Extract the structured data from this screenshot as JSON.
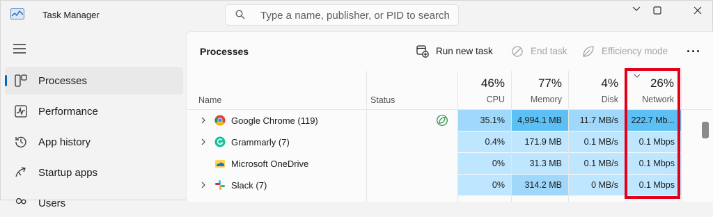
{
  "window": {
    "title": "Task Manager",
    "search_placeholder": "Type a name, publisher, or PID to search"
  },
  "sidebar": {
    "items": [
      {
        "label": "Processes",
        "icon": "processes-icon",
        "active": true
      },
      {
        "label": "Performance",
        "icon": "performance-icon",
        "active": false
      },
      {
        "label": "App history",
        "icon": "app-history-icon",
        "active": false
      },
      {
        "label": "Startup apps",
        "icon": "startup-apps-icon",
        "active": false
      },
      {
        "label": "Users",
        "icon": "users-icon",
        "active": false
      }
    ]
  },
  "toolbar": {
    "page_title": "Processes",
    "run_new_task": "Run new task",
    "end_task": "End task",
    "efficiency_mode": "Efficiency mode",
    "more": "···"
  },
  "table": {
    "headers": {
      "name": "Name",
      "status": "Status",
      "cpu": {
        "pct": "46%",
        "label": "CPU"
      },
      "memory": {
        "pct": "77%",
        "label": "Memory"
      },
      "disk": {
        "pct": "4%",
        "label": "Disk"
      },
      "network": {
        "pct": "26%",
        "label": "Network"
      }
    },
    "rows": [
      {
        "name": "Google Chrome (119)",
        "icon": "chrome-icon",
        "expandable": true,
        "efficiency": true,
        "cpu": "35.1%",
        "memory": "4,994.1 MB",
        "disk": "11.7 MB/s",
        "network": "222.7 Mb..."
      },
      {
        "name": "Grammarly (7)",
        "icon": "grammarly-icon",
        "expandable": true,
        "efficiency": false,
        "cpu": "0.4%",
        "memory": "171.9 MB",
        "disk": "0.1 MB/s",
        "network": "0.1 Mbps"
      },
      {
        "name": "Microsoft OneDrive",
        "icon": "onedrive-icon",
        "expandable": false,
        "efficiency": false,
        "cpu": "0%",
        "memory": "31.3 MB",
        "disk": "0.1 MB/s",
        "network": "0.1 Mbps"
      },
      {
        "name": "Slack (7)",
        "icon": "slack-icon",
        "expandable": true,
        "efficiency": false,
        "cpu": "0%",
        "memory": "314.2 MB",
        "disk": "0 MB/s",
        "network": "0.1 Mbps"
      }
    ]
  },
  "colors": {
    "accent": "#0067c0",
    "highlight_border": "#e3001b",
    "heat_light": "#bfe6ff",
    "heat_medium": "#9fd8fb",
    "heat_strong": "#5cc0f5"
  }
}
